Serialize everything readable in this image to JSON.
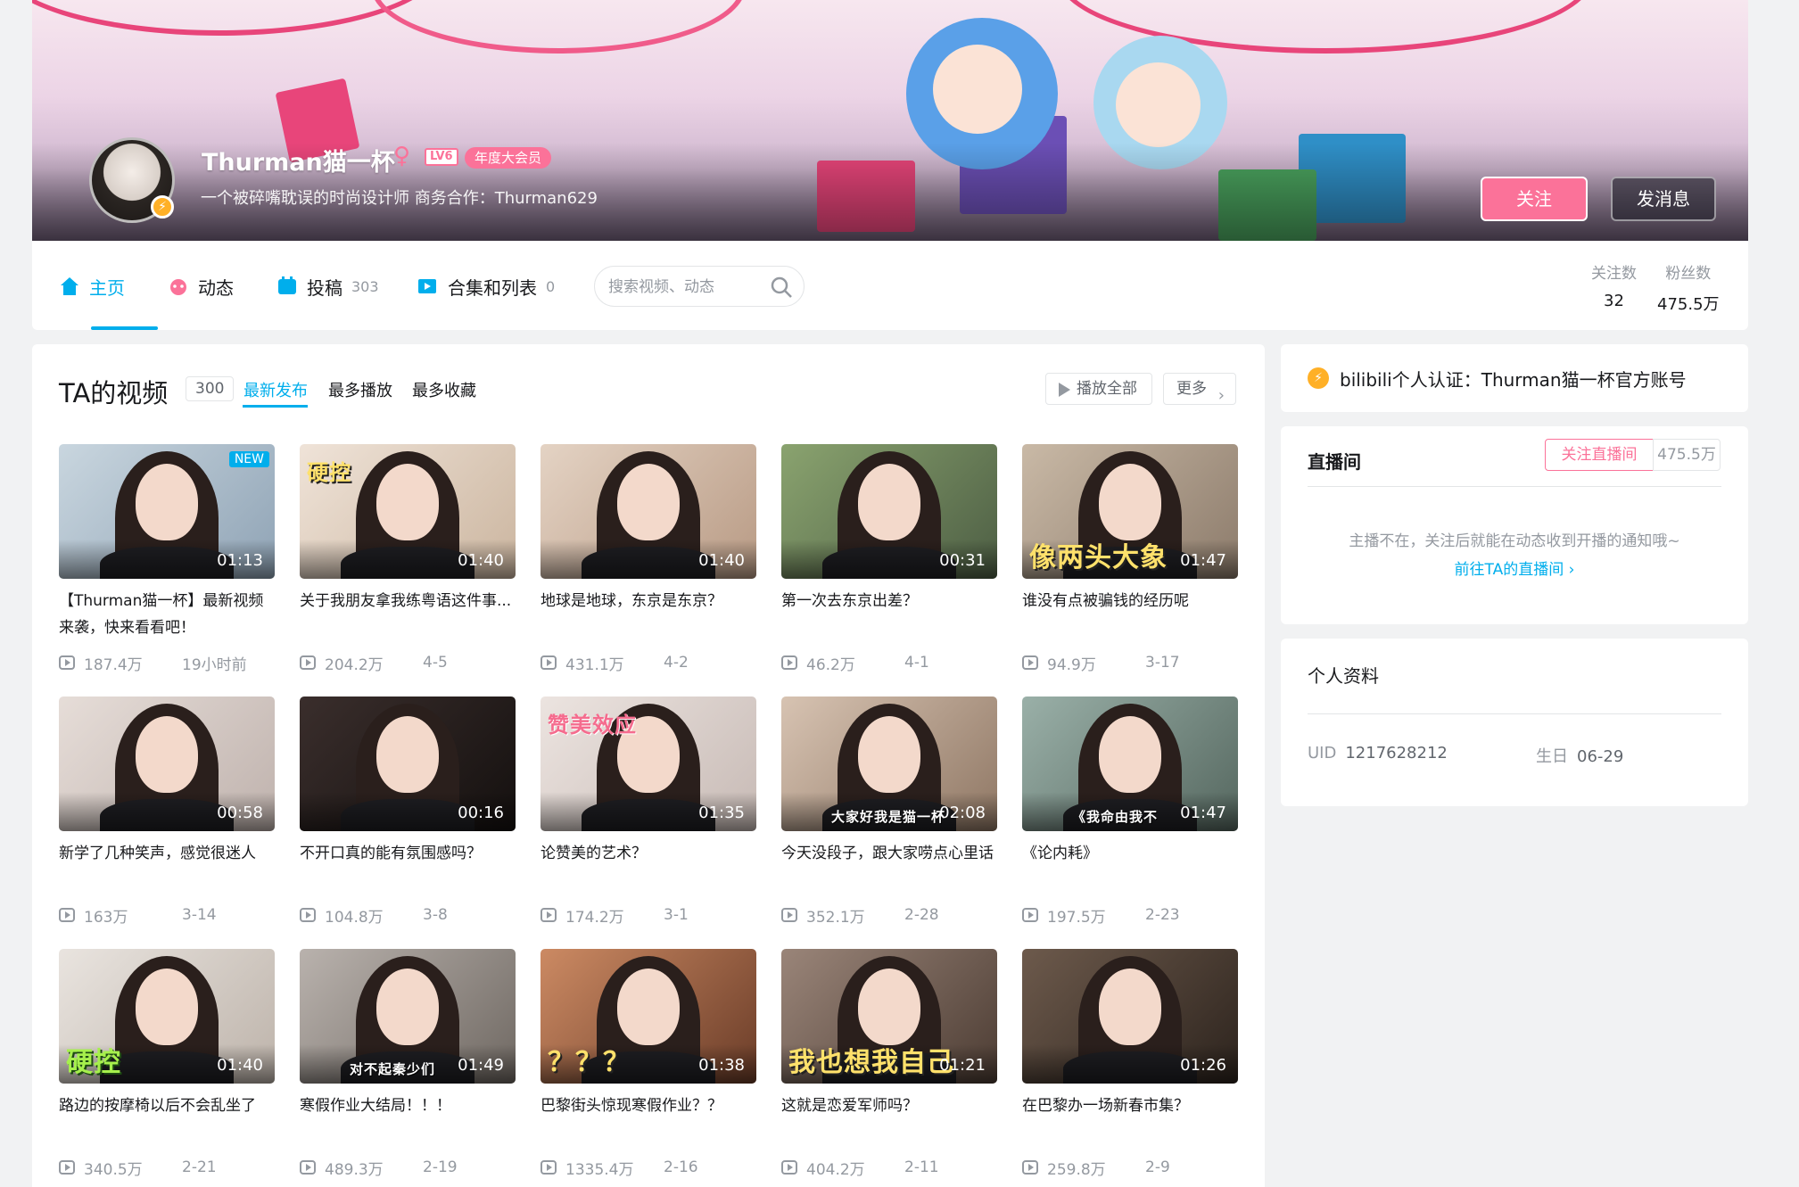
{
  "header": {
    "username": "Thurman猫一杯",
    "gender_icon": "female-icon",
    "level": "LV6",
    "vip_label": "年度大会员",
    "sign": "一个被碎嘴耽误的时尚设计师 商务合作：Thurman629",
    "follow_label": "关注",
    "message_label": "发消息",
    "colors": {
      "accent_pink": "#fb7299",
      "accent_blue": "#00aeec"
    }
  },
  "nav": {
    "tabs": [
      {
        "label": "主页",
        "count": "",
        "icon": "home-icon"
      },
      {
        "label": "动态",
        "count": "",
        "icon": "dynamic-icon"
      },
      {
        "label": "投稿",
        "count": "303",
        "icon": "upload-icon"
      },
      {
        "label": "合集和列表",
        "count": "0",
        "icon": "collection-icon"
      }
    ],
    "search_placeholder": "搜索视频、动态",
    "stats": [
      {
        "label": "关注数",
        "value": "32"
      },
      {
        "label": "粉丝数",
        "value": "475.5万"
      }
    ]
  },
  "videos_section": {
    "title": "TA的视频",
    "count": "300",
    "sort_tabs": [
      "最新发布",
      "最多播放",
      "最多收藏"
    ],
    "play_all_label": "播放全部",
    "more_label": "更多",
    "items": [
      {
        "title": "【Thurman猫一杯】最新视频来袭，快来看看吧！",
        "duration": "01:13",
        "views": "187.4万",
        "date": "19小时前",
        "badge": "NEW",
        "caption": ""
      },
      {
        "title": "关于我朋友拿我练粤语这件事...",
        "duration": "01:40",
        "views": "204.2万",
        "date": "4-5",
        "badge": "",
        "caption": "硬控"
      },
      {
        "title": "地球是地球，东京是东京？",
        "duration": "01:40",
        "views": "431.1万",
        "date": "4-2",
        "badge": "",
        "caption": ""
      },
      {
        "title": "第一次去东京出差？",
        "duration": "00:31",
        "views": "46.2万",
        "date": "4-1",
        "badge": "",
        "caption": ""
      },
      {
        "title": "谁没有点被骗钱的经历呢",
        "duration": "01:47",
        "views": "94.9万",
        "date": "3-17",
        "badge": "",
        "caption": "像两头大象"
      },
      {
        "title": "新学了几种笑声，感觉很迷人",
        "duration": "00:58",
        "views": "163万",
        "date": "3-14",
        "badge": "",
        "caption": ""
      },
      {
        "title": "不开口真的能有氛围感吗？",
        "duration": "00:16",
        "views": "104.8万",
        "date": "3-8",
        "badge": "",
        "caption": ""
      },
      {
        "title": "论赞美的艺术？",
        "duration": "01:35",
        "views": "174.2万",
        "date": "3-1",
        "badge": "",
        "caption": "赞美效应"
      },
      {
        "title": "今天没段子，跟大家唠点心里话",
        "duration": "02:08",
        "views": "352.1万",
        "date": "2-28",
        "badge": "",
        "caption": "大家好我是猫一杯"
      },
      {
        "title": "《论内耗》",
        "duration": "01:47",
        "views": "197.5万",
        "date": "2-23",
        "badge": "",
        "caption": "《我命由我不"
      },
      {
        "title": "路边的按摩椅以后不会乱坐了",
        "duration": "01:40",
        "views": "340.5万",
        "date": "2-21",
        "badge": "",
        "caption": "硬控"
      },
      {
        "title": "寒假作业大结局！！！",
        "duration": "01:49",
        "views": "489.3万",
        "date": "2-19",
        "badge": "",
        "caption": "对不起秦少们"
      },
      {
        "title": "巴黎街头惊现寒假作业？？",
        "duration": "01:38",
        "views": "1335.4万",
        "date": "2-16",
        "badge": "",
        "caption": "？？？"
      },
      {
        "title": "这就是恋爱军师吗？",
        "duration": "01:21",
        "views": "404.2万",
        "date": "2-11",
        "badge": "",
        "caption": "我也想我自己"
      },
      {
        "title": "在巴黎办一场新春市集？",
        "duration": "01:26",
        "views": "259.8万",
        "date": "2-9",
        "badge": "",
        "caption": ""
      }
    ]
  },
  "side": {
    "verify_text": "bilibili个人认证：Thurman猫一杯官方账号",
    "live": {
      "title": "直播间",
      "follow_live_label": "关注直播间",
      "follower_count": "475.5万",
      "tip": "主播不在，关注后就能在动态收到开播的通知哦~",
      "link": "前往TA的直播间 ›"
    },
    "profile": {
      "title": "个人资料",
      "uid_label": "UID",
      "uid_value": "1217628212",
      "birthday_label": "生日",
      "birthday_value": "06-29"
    }
  }
}
